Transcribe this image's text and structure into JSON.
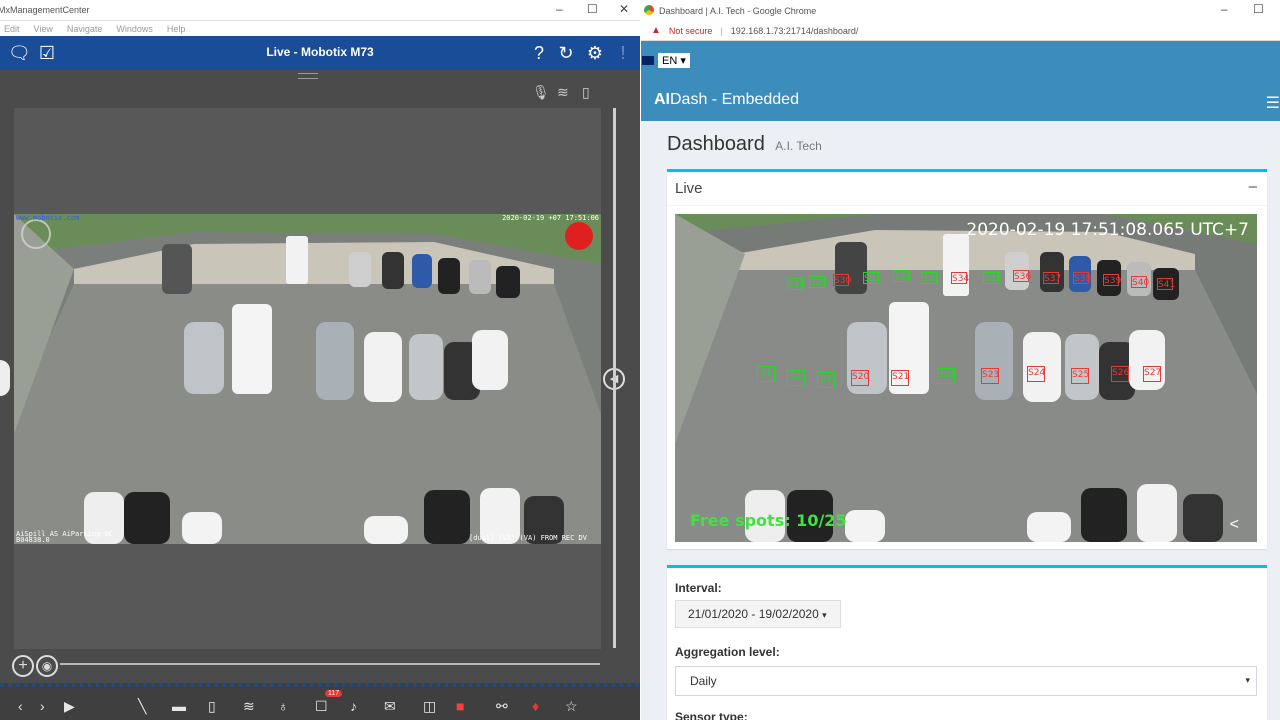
{
  "left_window": {
    "title": "MxManagementCenter",
    "menu": [
      "Edit",
      "View",
      "Navigate",
      "Windows",
      "Help"
    ],
    "header_title": "Live - Mobotix M73",
    "cam_overlay_top_left": "www.mobotix.com",
    "cam_overlay_top_right": "2020-02-19 +07 17:51:06",
    "cam_overlay_bottom_left_1": "AiSpill AS AiParking UC",
    "cam_overlay_bottom_left_2": "B04838.0",
    "cam_overlay_bottom_right": "[dual] (VA) (VA) FROM REC DV",
    "badge_count": "117",
    "icons": {
      "chat": "chat-icon",
      "check": "checklist-icon",
      "help": "help-icon",
      "refresh": "refresh-icon",
      "settings": "gear-icon"
    }
  },
  "right_window": {
    "browser_title": "Dashboard | A.I. Tech - Google Chrome",
    "not_secure": "Not secure",
    "url": "192.168.1.73:21714/dashboard/",
    "lang": "EN ▾",
    "brand_bold": "AI",
    "brand_rest": "Dash - Embedded",
    "page_title": "Dashboard",
    "page_subtitle": "A.I. Tech",
    "live_title": "Live",
    "collapse_symbol": "–",
    "timestamp": "2020-02-19 17:51:08.065 UTC+7",
    "free_spots": "Free spots: 10/25",
    "nav_back": "<",
    "interval_label": "Interval:",
    "interval_value": "21/01/2020 - 19/02/2020",
    "agg_label": "Aggregation level:",
    "agg_value": "Daily",
    "sensor_label": "Sensor type:",
    "detections": [
      {
        "label": "S1",
        "status": "free"
      },
      {
        "label": "S2",
        "status": "free"
      },
      {
        "label": "S3",
        "status": "free"
      },
      {
        "label": "S20",
        "status": "occupied"
      },
      {
        "label": "S21",
        "status": "occupied"
      },
      {
        "label": "S22",
        "status": "free"
      },
      {
        "label": "S23",
        "status": "occupied"
      },
      {
        "label": "S24",
        "status": "occupied"
      },
      {
        "label": "S25",
        "status": "occupied"
      },
      {
        "label": "S26",
        "status": "occupied"
      },
      {
        "label": "S27",
        "status": "occupied"
      },
      {
        "label": "S28",
        "status": "free"
      },
      {
        "label": "S29",
        "status": "free"
      },
      {
        "label": "S30",
        "status": "occupied"
      },
      {
        "label": "S31",
        "status": "free"
      },
      {
        "label": "S32",
        "status": "free"
      },
      {
        "label": "S33",
        "status": "free"
      },
      {
        "label": "S34",
        "status": "occupied"
      },
      {
        "label": "S35",
        "status": "free"
      },
      {
        "label": "S36",
        "status": "occupied"
      },
      {
        "label": "S37",
        "status": "occupied"
      },
      {
        "label": "S38",
        "status": "occupied"
      },
      {
        "label": "S39",
        "status": "occupied"
      },
      {
        "label": "S40",
        "status": "occupied"
      },
      {
        "label": "S41",
        "status": "occupied"
      }
    ],
    "colors": {
      "header": "#3c8dbc",
      "free": "#2ad62a",
      "occupied": "#e23b3b",
      "box_top": "#00c0ef"
    }
  }
}
